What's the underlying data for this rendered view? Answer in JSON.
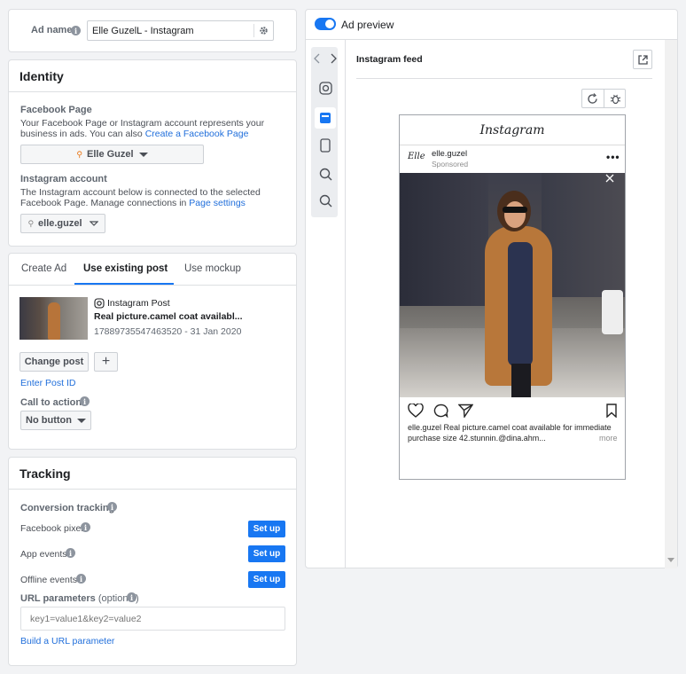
{
  "ad_name": {
    "label": "Ad name",
    "value": "Elle GuzelL - Instagram"
  },
  "identity": {
    "title": "Identity",
    "fb_page_label": "Facebook Page",
    "fb_page_desc": "Your Facebook Page or Instagram account represents your business in ads. You can also ",
    "fb_page_link": "Create a Facebook Page",
    "fb_page_value": "Elle Guzel",
    "ig_label": "Instagram account",
    "ig_desc": "The Instagram account below is connected to the selected Facebook Page. Manage connections in ",
    "ig_link": "Page settings",
    "ig_value": "elle.guzel"
  },
  "creative": {
    "tabs": [
      "Create Ad",
      "Use existing post",
      "Use mockup"
    ],
    "post_type": "Instagram Post",
    "post_title": "Real picture.camel coat availabl...",
    "post_meta": "17889735547463520 - 31 Jan 2020",
    "change_post": "Change post",
    "enter_post_id": "Enter Post ID",
    "cta_label": "Call to action",
    "cta_value": "No button"
  },
  "tracking": {
    "title": "Tracking",
    "conversion_label": "Conversion tracking",
    "rows": [
      {
        "label": "Facebook pixel",
        "button": "Set up"
      },
      {
        "label": "App events",
        "button": "Set up"
      },
      {
        "label": "Offline events",
        "button": "Set up"
      }
    ],
    "url_label": "URL parameters",
    "url_optional": "(optional)",
    "url_placeholder": "key1=value1&key2=value2",
    "build_link": "Build a URL parameter"
  },
  "preview": {
    "toggle_label": "Ad preview",
    "placement": "Instagram feed",
    "ig_logo": "Instagram",
    "account": "elle.guzel",
    "sponsored": "Sponsored",
    "avatar_text": "Elle",
    "caption_user": "elle.guzel",
    "caption_text": " Real picture.camel coat available for immediate purchase size 42.stunnin.@dina.ahm...",
    "more": "more"
  },
  "colors": {
    "accent": "#1877f2",
    "link": "#216fdb",
    "border": "#dddfe2"
  }
}
